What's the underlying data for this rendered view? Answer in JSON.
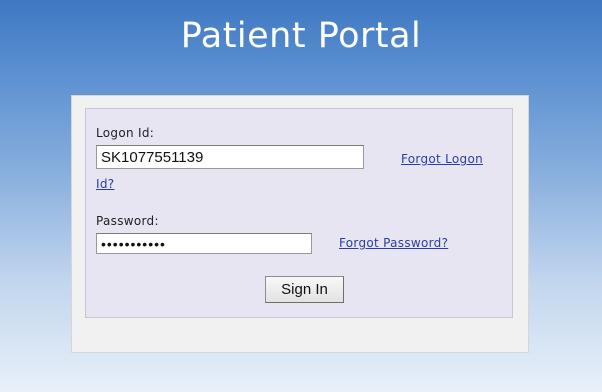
{
  "header": {
    "title": "Patient Portal"
  },
  "login_form": {
    "logon_label": "Logon Id:",
    "logon_value": "SK1077551139",
    "forgot_logon_line1": "Forgot Logon",
    "forgot_logon_line2": "Id?",
    "password_label": "Password:",
    "password_value": "•••••••••••",
    "forgot_password": "Forgot Password?",
    "sign_in_label": "Sign In"
  },
  "colors": {
    "background_top": "#3f78c2",
    "background_bottom": "#e8f0f9",
    "panel": "#f1f1f1",
    "login_box": "#e6e5f1",
    "link": "#2b3ea8"
  }
}
